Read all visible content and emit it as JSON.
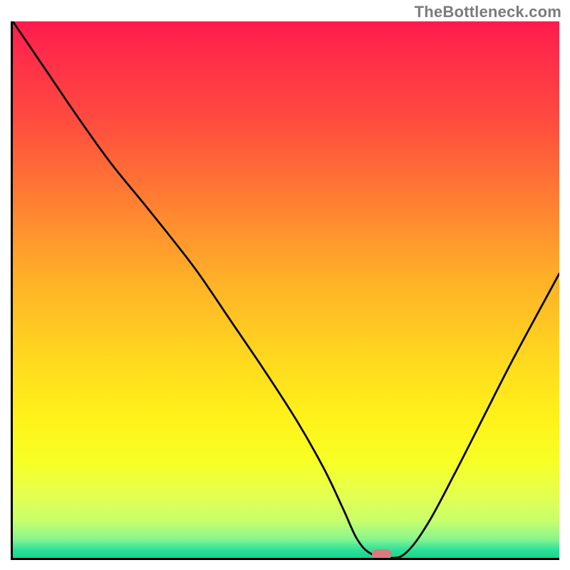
{
  "attribution": "TheBottleneck.com",
  "gradient_stops": [
    {
      "offset": 0.0,
      "color": "#ff1a4d"
    },
    {
      "offset": 0.05,
      "color": "#ff2a4a"
    },
    {
      "offset": 0.18,
      "color": "#ff4a3f"
    },
    {
      "offset": 0.32,
      "color": "#ff7a33"
    },
    {
      "offset": 0.48,
      "color": "#ffb028"
    },
    {
      "offset": 0.62,
      "color": "#ffd61f"
    },
    {
      "offset": 0.74,
      "color": "#fff21a"
    },
    {
      "offset": 0.82,
      "color": "#f7ff24"
    },
    {
      "offset": 0.88,
      "color": "#e6ff4e"
    },
    {
      "offset": 0.93,
      "color": "#c8ff6a"
    },
    {
      "offset": 0.965,
      "color": "#88f58e"
    },
    {
      "offset": 0.985,
      "color": "#2ee09a"
    },
    {
      "offset": 1.0,
      "color": "#14d68e"
    }
  ],
  "chart_data": {
    "type": "line",
    "title": "",
    "xlabel": "",
    "ylabel": "",
    "xlim": [
      0,
      1
    ],
    "ylim": [
      0,
      1
    ],
    "grid": false,
    "legend": false,
    "series": [
      {
        "name": "curve",
        "x": [
          0.0,
          0.06,
          0.12,
          0.18,
          0.24,
          0.295,
          0.34,
          0.4,
          0.46,
          0.52,
          0.57,
          0.605,
          0.63,
          0.655,
          0.69,
          0.72,
          0.76,
          0.81,
          0.86,
          0.91,
          0.96,
          1.0
        ],
        "y": [
          1.0,
          0.91,
          0.82,
          0.735,
          0.66,
          0.59,
          0.53,
          0.44,
          0.35,
          0.255,
          0.165,
          0.09,
          0.035,
          0.008,
          0.0,
          0.01,
          0.065,
          0.16,
          0.26,
          0.36,
          0.455,
          0.53
        ]
      }
    ],
    "marker": {
      "name": "optimal-point",
      "x": 0.675,
      "y": 0.002,
      "color": "#d77b7f"
    }
  }
}
